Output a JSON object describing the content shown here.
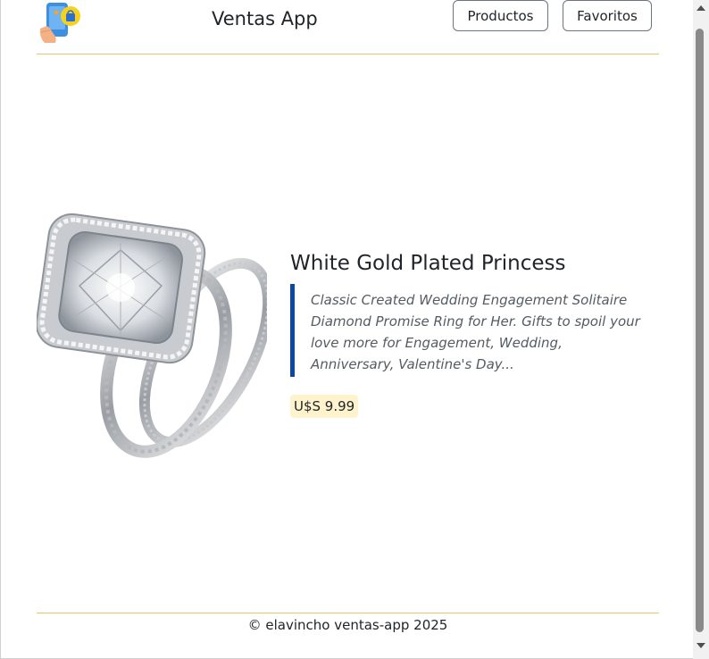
{
  "header": {
    "app_title": "Ventas App",
    "nav": [
      {
        "label": "Productos"
      },
      {
        "label": "Favoritos"
      }
    ]
  },
  "product": {
    "title": "White Gold Plated Princess",
    "description": "Classic Created Wedding Engagement Solitaire Diamond Promise Ring for Her. Gifts to spoil your love more for Engagement, Wedding, Anniversary, Valentine's Day...",
    "price": "U$S 9.99",
    "image_icon": "ring-image"
  },
  "footer": {
    "text": "© elavincho ventas-app 2025"
  },
  "colors": {
    "divider": "#e9c46a",
    "quote_border": "#0d47a1",
    "price_bg": "#fff3cd"
  }
}
